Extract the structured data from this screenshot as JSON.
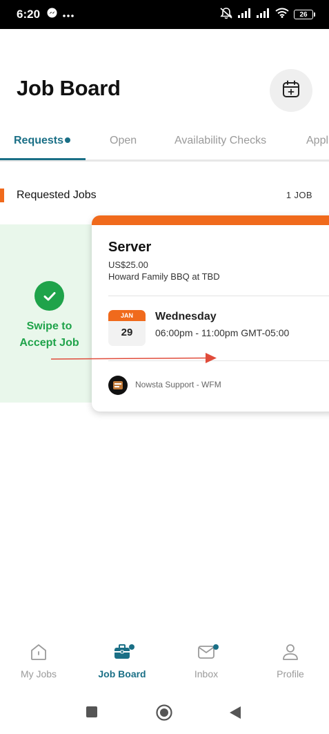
{
  "status_bar": {
    "time": "6:20",
    "left_icons": [
      "messenger-icon",
      "more-dots-icon"
    ],
    "right_icons": [
      "mute-icon",
      "signal-icon",
      "signal-icon",
      "wifi-icon"
    ],
    "battery": "26"
  },
  "header": {
    "title": "Job Board",
    "action_icon": "calendar-add-icon"
  },
  "tabs": [
    {
      "label": "Requests",
      "active": true,
      "has_dot": true
    },
    {
      "label": "Open",
      "active": false
    },
    {
      "label": "Availability Checks",
      "active": false
    },
    {
      "label": "Appl",
      "active": false
    }
  ],
  "section": {
    "title": "Requested Jobs",
    "count": "1 JOB"
  },
  "swipe_action": {
    "label_line1": "Swipe to",
    "label_line2": "Accept Job",
    "icon": "check-icon"
  },
  "job": {
    "role": "Server",
    "pay": "US$25.00",
    "location": "Howard Family BBQ at TBD",
    "date_month": "JAN",
    "date_day": "29",
    "weekday": "Wednesday",
    "time": "06:00pm - 11:00pm GMT-05:00",
    "company": "Nowsta Support - WFM"
  },
  "bottom_nav": [
    {
      "label": "My Jobs",
      "icon": "home-icon",
      "active": false
    },
    {
      "label": "Job Board",
      "icon": "briefcase-icon",
      "active": true
    },
    {
      "label": "Inbox",
      "icon": "mail-icon",
      "active": false
    },
    {
      "label": "Profile",
      "icon": "person-icon",
      "active": false
    }
  ],
  "colors": {
    "accent": "#1a6f86",
    "orange": "#f06a1c",
    "accept_green": "#1fa34a",
    "accept_bg": "#e9f7eb",
    "arrow": "#e04b3a"
  }
}
